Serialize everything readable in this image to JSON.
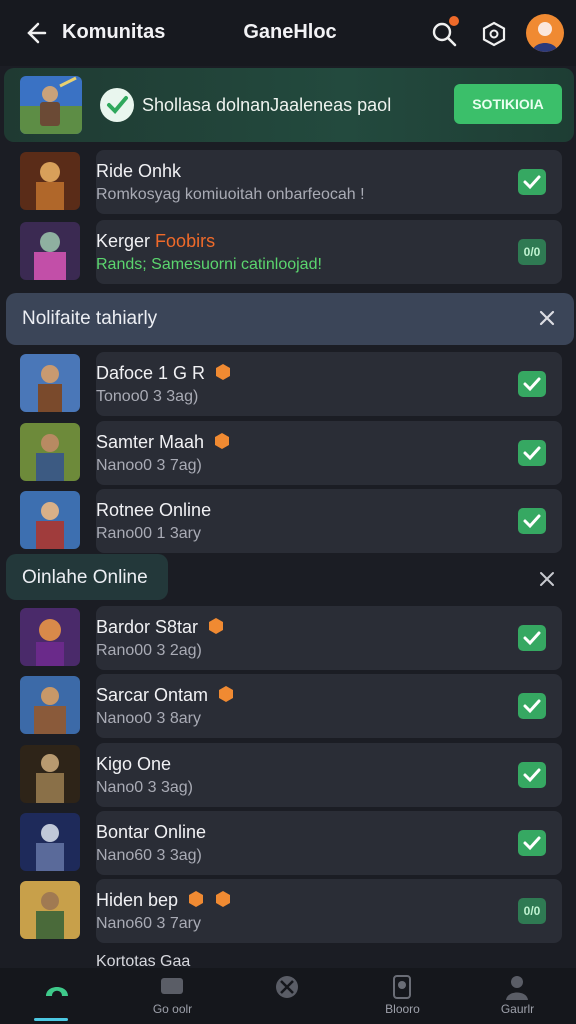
{
  "header": {
    "back_icon": "back-arrow-icon",
    "title": "Komunitas",
    "center_title": "GaneHloc",
    "icons": [
      "search-icon",
      "settings-hex-icon",
      "avatar"
    ]
  },
  "banner": {
    "text": "Shollasa dolnanJaaleneas paol",
    "button": "SOTIKIOIA"
  },
  "top_rows": [
    {
      "title": "Ride Onhk",
      "subtitle": "Romkosyag komiuoitah onbarfeocah !",
      "sub_green": false,
      "check": "check"
    },
    {
      "title": "Kerger",
      "title_accent": "Foobirs",
      "subtitle": "Rands; Samesuorni catinloojad!",
      "sub_green": true,
      "check": "0/0"
    }
  ],
  "section1": {
    "label": "Nolifaite tahiarly"
  },
  "section1_rows": [
    {
      "title": "Dafoce 1 G R",
      "subtitle": "Tonoo0 3 3ag)",
      "badge": true
    },
    {
      "title": "Samter Maah",
      "subtitle": "Nanoo0 3 7ag)",
      "badge": true
    },
    {
      "title": "Rotnee Online",
      "subtitle": "Rano00 1 3ary",
      "badge": false
    }
  ],
  "section2": {
    "label": "Oinlahe Online"
  },
  "section2_rows": [
    {
      "title": "Bardor S8tar",
      "subtitle": "Rano00 3 2ag)",
      "badge": true,
      "check": "check"
    },
    {
      "title": "Sarcar Ontam",
      "subtitle": "Nanoo0 3 8ary",
      "badge": true,
      "check": "check"
    },
    {
      "title": "Kigo One",
      "subtitle": "Nano0 3 3ag)",
      "badge": false,
      "check": "check"
    },
    {
      "title": "Bontar Online",
      "subtitle": "Nano60 3 3ag)",
      "badge": false,
      "check": "check"
    },
    {
      "title": "Hiden bep",
      "subtitle": "Nano60 3 7ary",
      "badge": true,
      "check": "0/0"
    }
  ],
  "partial_row": "Kortotas Gaa",
  "bottom_nav": [
    {
      "label": "",
      "icon": "home-icon",
      "active": true
    },
    {
      "label": "Go oolr",
      "icon": "chat-icon",
      "active": false
    },
    {
      "label": "",
      "icon": "xbox-icon",
      "active": false
    },
    {
      "label": "Blooro",
      "icon": "device-icon",
      "active": false
    },
    {
      "label": "Gaurlr",
      "icon": "profile-icon",
      "active": false
    }
  ],
  "colors": {
    "accent_green": "#3bbf6a",
    "background": "#1b1d24",
    "row_bg": "#2a2d36",
    "badge_orange": "#f08a32"
  }
}
